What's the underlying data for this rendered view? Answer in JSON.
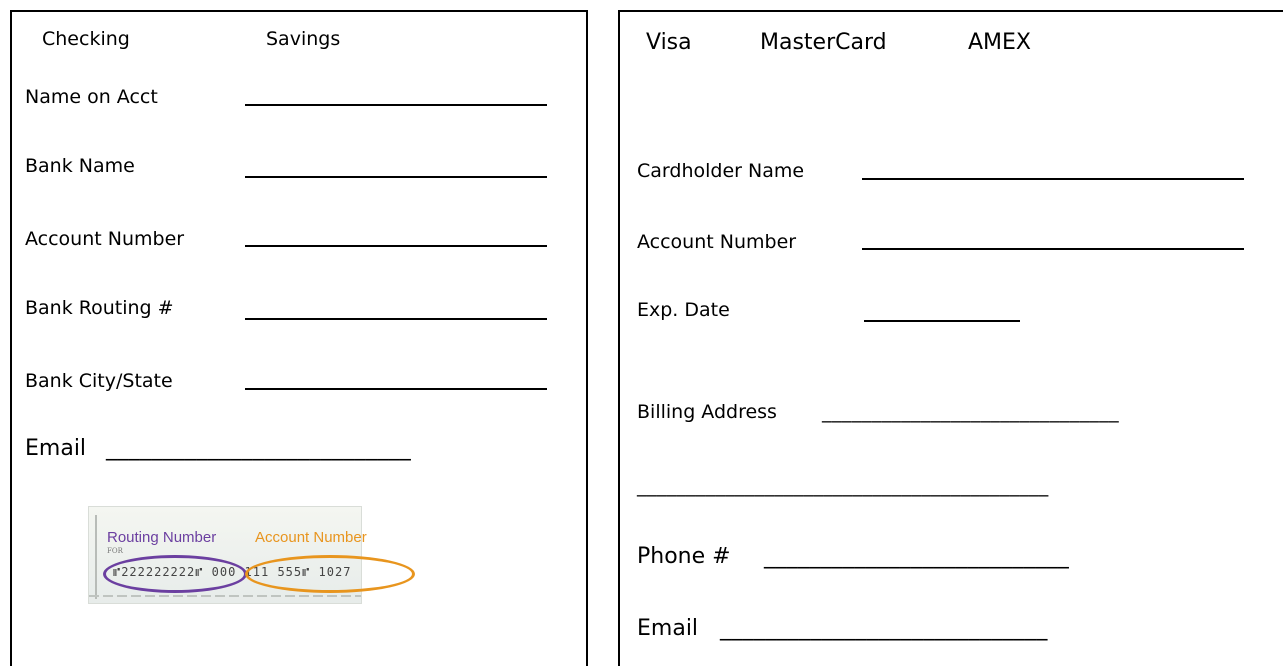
{
  "left": {
    "account_types": [
      "Checking",
      "Savings"
    ],
    "fields": [
      {
        "label": "Name on Acct"
      },
      {
        "label": "Bank Name"
      },
      {
        "label": "Account Number"
      },
      {
        "label": "Bank Routing #"
      },
      {
        "label": "Bank City/State"
      }
    ],
    "email": {
      "label": "Email",
      "blank": "___________________________"
    },
    "check": {
      "routing_label": "Routing Number",
      "account_label": "Account Number",
      "for_text": "FOR",
      "micr": "⑈222222222⑈ 000 111 555⑈ 1027",
      "routing_color": "#6b3fa0",
      "account_color": "#e8951e"
    }
  },
  "right": {
    "card_types": [
      "Visa",
      "MasterCard",
      "AMEX"
    ],
    "fields": [
      {
        "label": "Cardholder Name"
      },
      {
        "label": "Account Number"
      },
      {
        "label": "Exp. Date"
      }
    ],
    "billing": {
      "label": "Billing Address",
      "blank": "______________________________",
      "blank2": "__________________________________________"
    },
    "phone": {
      "label": "Phone #",
      "blank": "___________________________"
    },
    "email": {
      "label": "Email",
      "blank": "_____________________________"
    }
  }
}
